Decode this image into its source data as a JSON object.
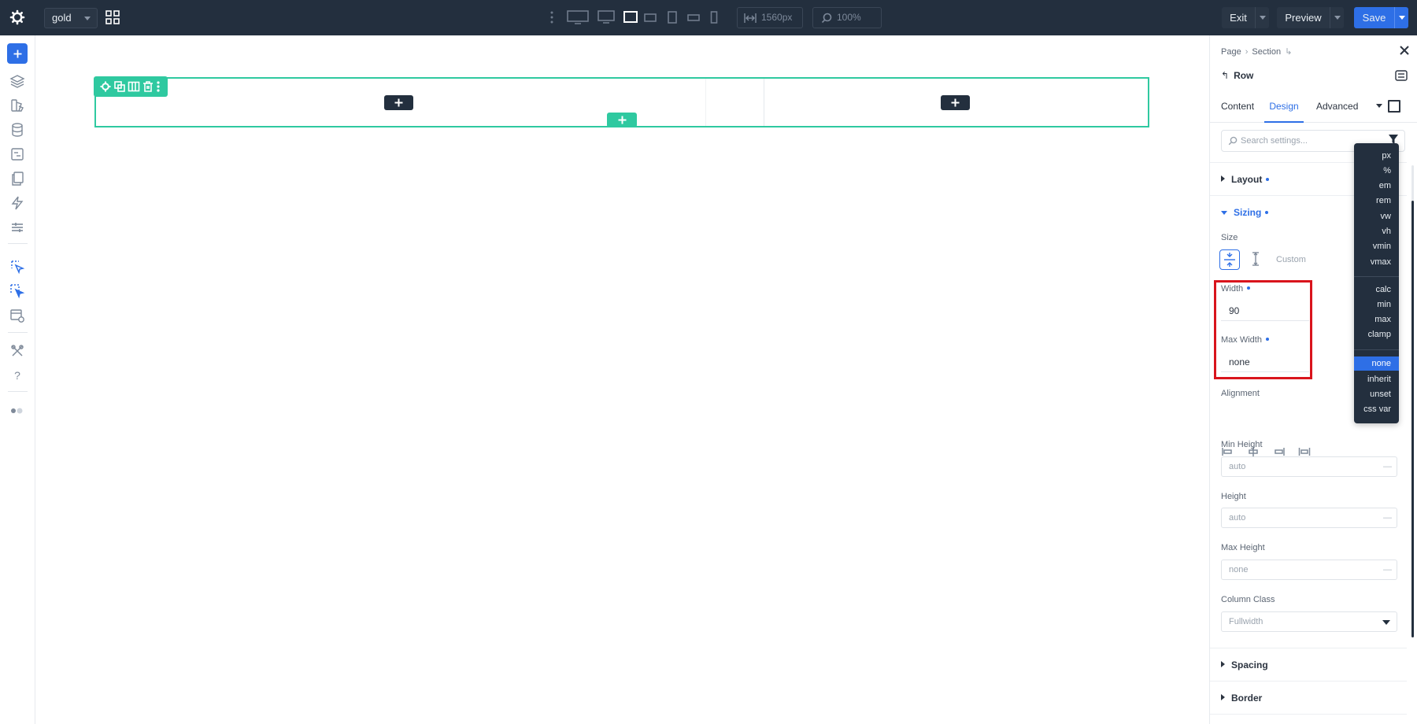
{
  "topbar": {
    "workspace": "gold",
    "width_value": "1560px",
    "zoom_value": "100%",
    "exit_label": "Exit",
    "preview_label": "Preview",
    "save_label": "Save"
  },
  "canvas": {
    "add_row_icon": "plus-icon",
    "add_module_icon": "plus-icon"
  },
  "panel": {
    "breadcrumb": [
      "Page",
      "Section"
    ],
    "element_title": "Row",
    "tabs": [
      "Content",
      "Design",
      "Advanced"
    ],
    "active_tab": "Design",
    "search_placeholder": "Search settings...",
    "sections": {
      "layout": "Layout",
      "sizing": "Sizing",
      "spacing": "Spacing",
      "border": "Border"
    },
    "sizing": {
      "size_label": "Size",
      "custom_label": "Custom",
      "width_label": "Width",
      "width_value": "90",
      "max_width_label": "Max Width",
      "max_width_value": "none",
      "alignment_label": "Alignment",
      "min_height_label": "Min Height",
      "min_height_placeholder": "auto",
      "height_label": "Height",
      "height_placeholder": "auto",
      "max_height_label": "Max Height",
      "max_height_placeholder": "none",
      "column_class_label": "Column Class",
      "column_class_value": "Fullwidth",
      "dash": "—"
    }
  },
  "units_dropdown": {
    "group1": [
      "px",
      "%",
      "em",
      "rem",
      "vw",
      "vh",
      "vmin",
      "vmax"
    ],
    "group2": [
      "calc",
      "min",
      "max",
      "clamp"
    ],
    "group3": [
      "none",
      "inherit",
      "unset",
      "css var"
    ],
    "selected": "none"
  },
  "colors": {
    "accent": "#2e6fe6",
    "row_outline": "#2fc9a0",
    "topbar_bg": "#232f3e",
    "highlight": "#d9141c"
  }
}
